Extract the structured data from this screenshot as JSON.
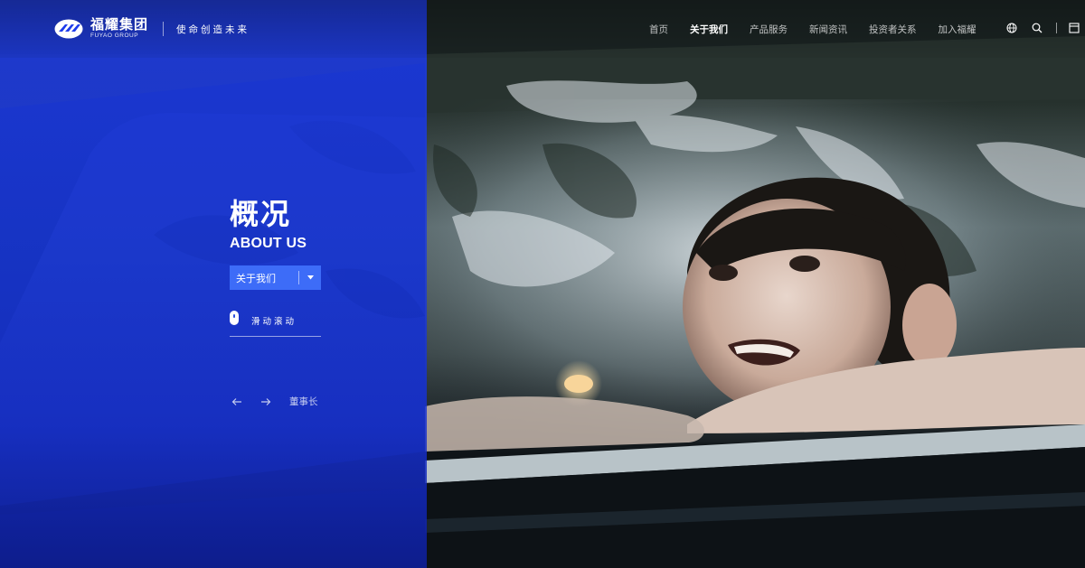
{
  "brand": {
    "name_cn": "福耀集团",
    "name_en": "FUYAO GROUP",
    "slogan": "使命创造未来"
  },
  "nav": {
    "items": [
      {
        "label": "首页",
        "active": false
      },
      {
        "label": "关于我们",
        "active": true
      },
      {
        "label": "产品服务",
        "active": false
      },
      {
        "label": "新闻资讯",
        "active": false
      },
      {
        "label": "投资者关系",
        "active": false
      },
      {
        "label": "加入福耀",
        "active": false
      }
    ],
    "icons": [
      "globe-icon",
      "search-icon",
      "menu-icon"
    ]
  },
  "hero": {
    "title": "概况",
    "subtitle": "ABOUT US",
    "dropdown_label": "关于我们",
    "scroll_label": "滑动滚动",
    "next_label": "董事长"
  },
  "colors": {
    "panel_blue": "#1e3ceb",
    "dropdown_blue": "#3d6cf8"
  }
}
